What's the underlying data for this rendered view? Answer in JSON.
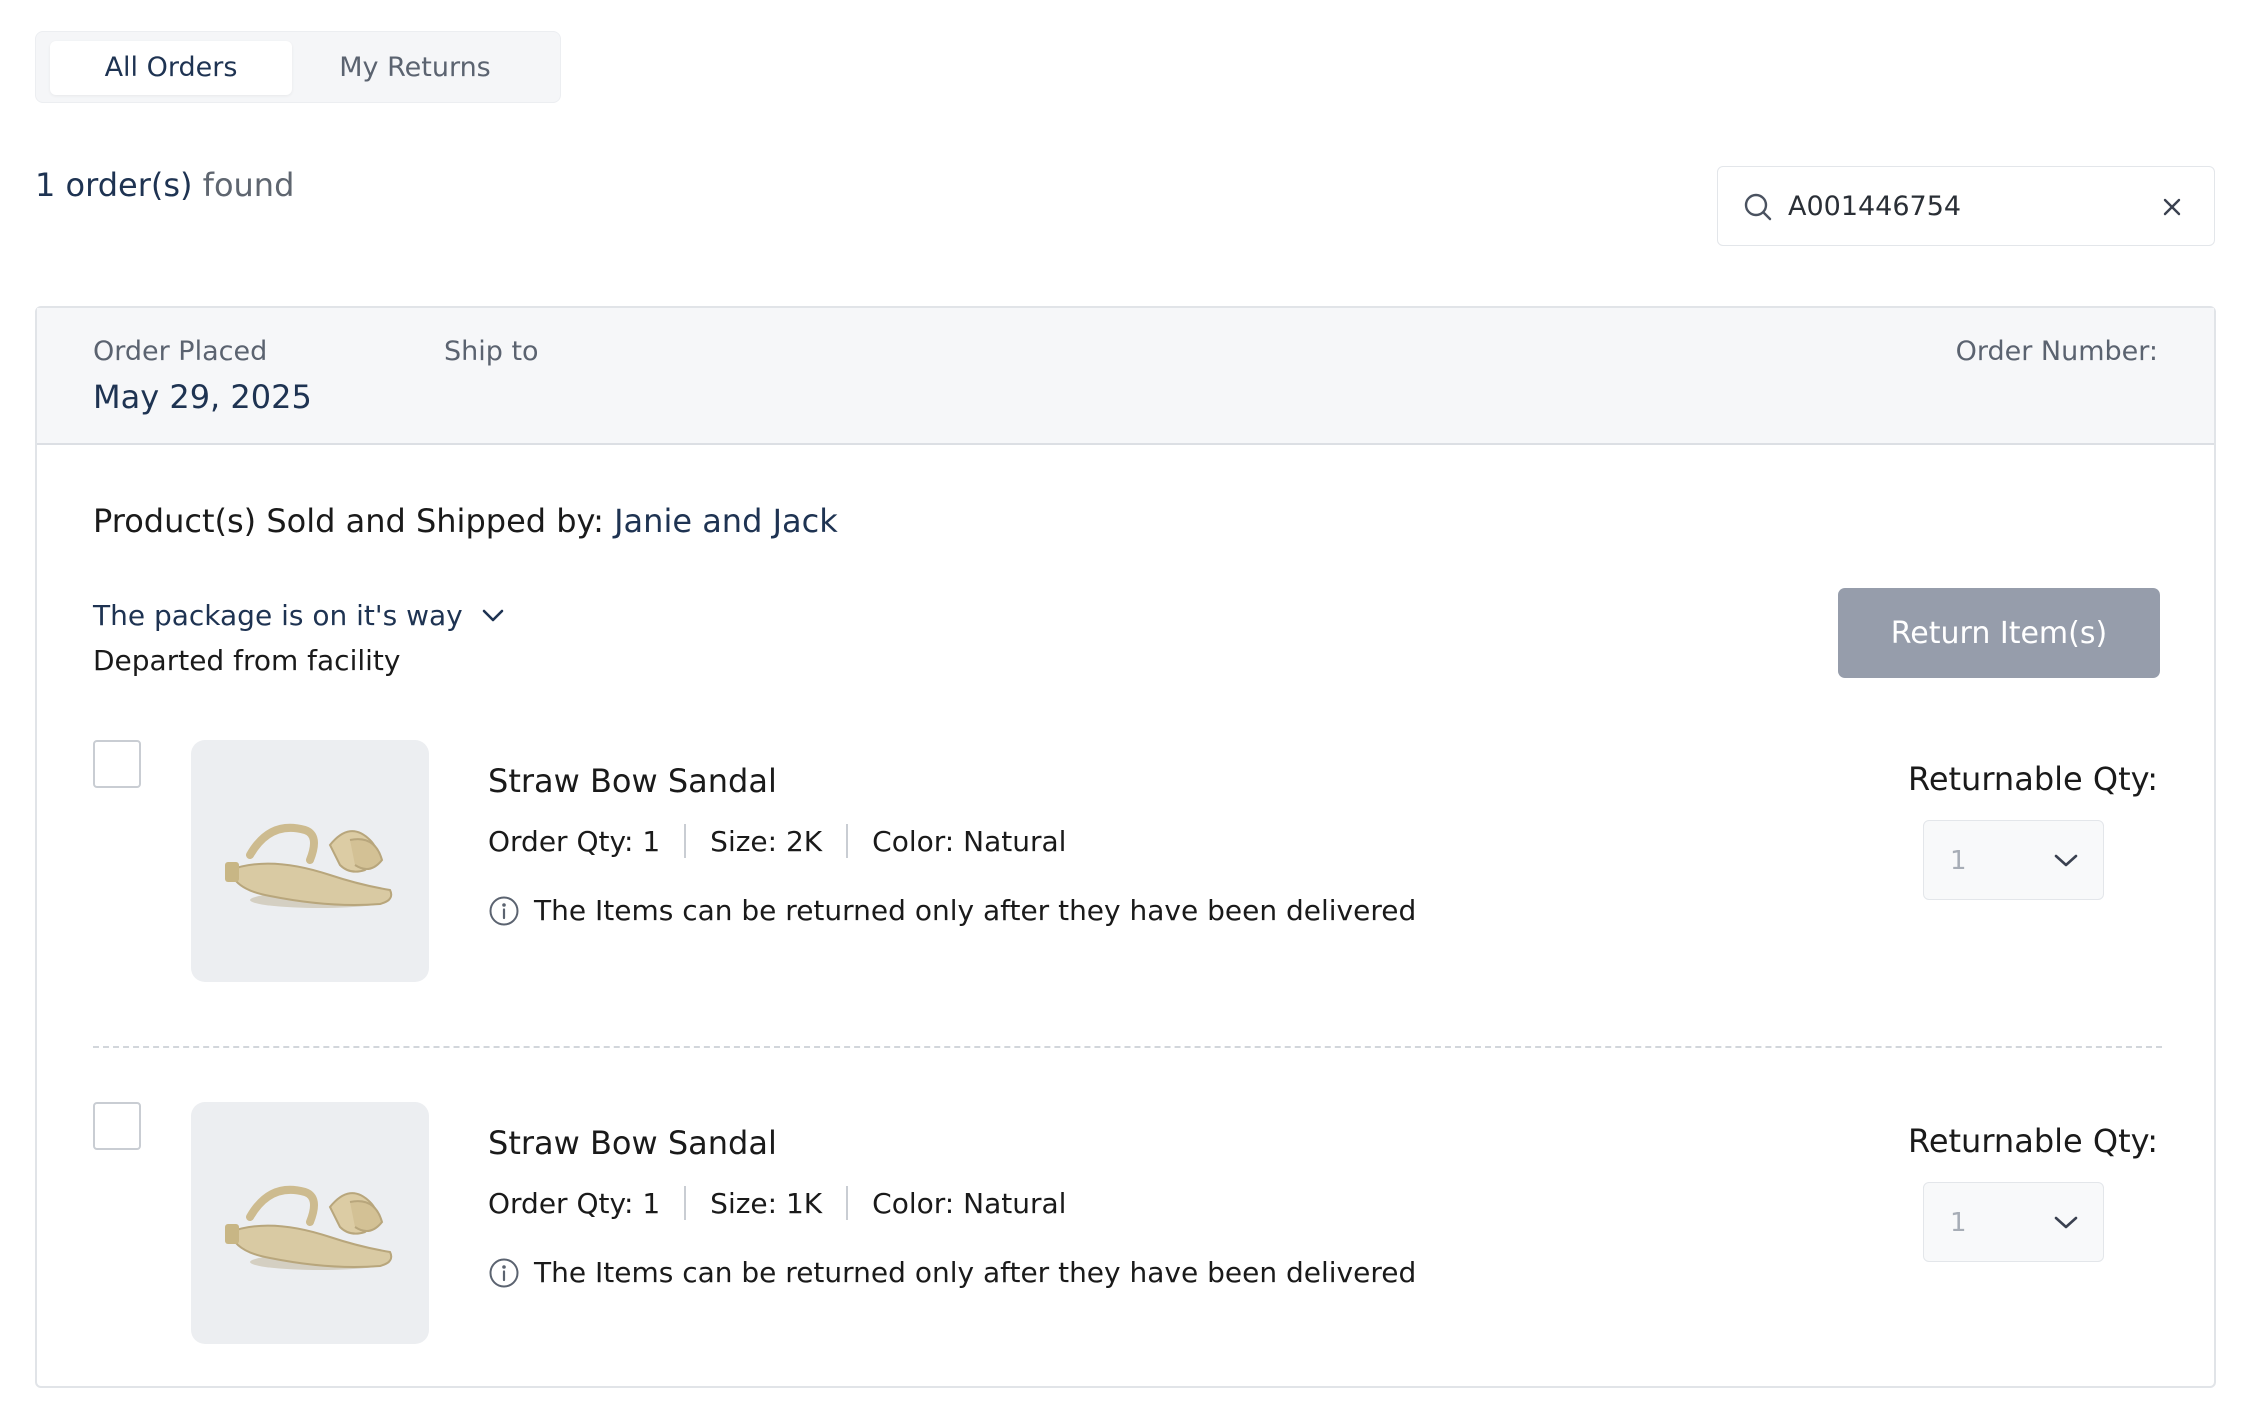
{
  "tabs": [
    {
      "label": "All Orders",
      "active": true
    },
    {
      "label": "My Returns",
      "active": false
    }
  ],
  "results": {
    "count_text": "1 order(s)",
    "suffix": "found"
  },
  "search": {
    "value": "A001446754"
  },
  "order": {
    "placed_label": "Order Placed",
    "placed_date": "May 29, 2025",
    "ship_to_label": "Ship to",
    "order_number_label": "Order Number:",
    "seller_label": "Product(s) Sold and Shipped by:",
    "seller_name": "Janie and Jack",
    "status": "The package is on it's way",
    "status_detail": "Departed from facility",
    "return_button": "Return Item(s)"
  },
  "items": [
    {
      "name": "Straw Bow Sandal",
      "qty": "Order Qty: 1",
      "size": "Size: 2K",
      "color": "Color: Natural",
      "note": "The Items can be returned only after they have been delivered",
      "returnable_label": "Returnable Qty:",
      "returnable_value": "1"
    },
    {
      "name": "Straw Bow Sandal",
      "qty": "Order Qty: 1",
      "size": "Size: 1K",
      "color": "Color: Natural",
      "note": "The Items can be returned only after they have been delivered",
      "returnable_label": "Returnable Qty:",
      "returnable_value": "1"
    }
  ],
  "colors": {
    "accent": "#1e3352",
    "button_disabled": "#969dab",
    "header_bg": "#f6f7f9"
  },
  "icons": {
    "search": "search-icon",
    "clear": "close-icon",
    "expand": "chevron-down-icon",
    "info": "info-icon"
  }
}
